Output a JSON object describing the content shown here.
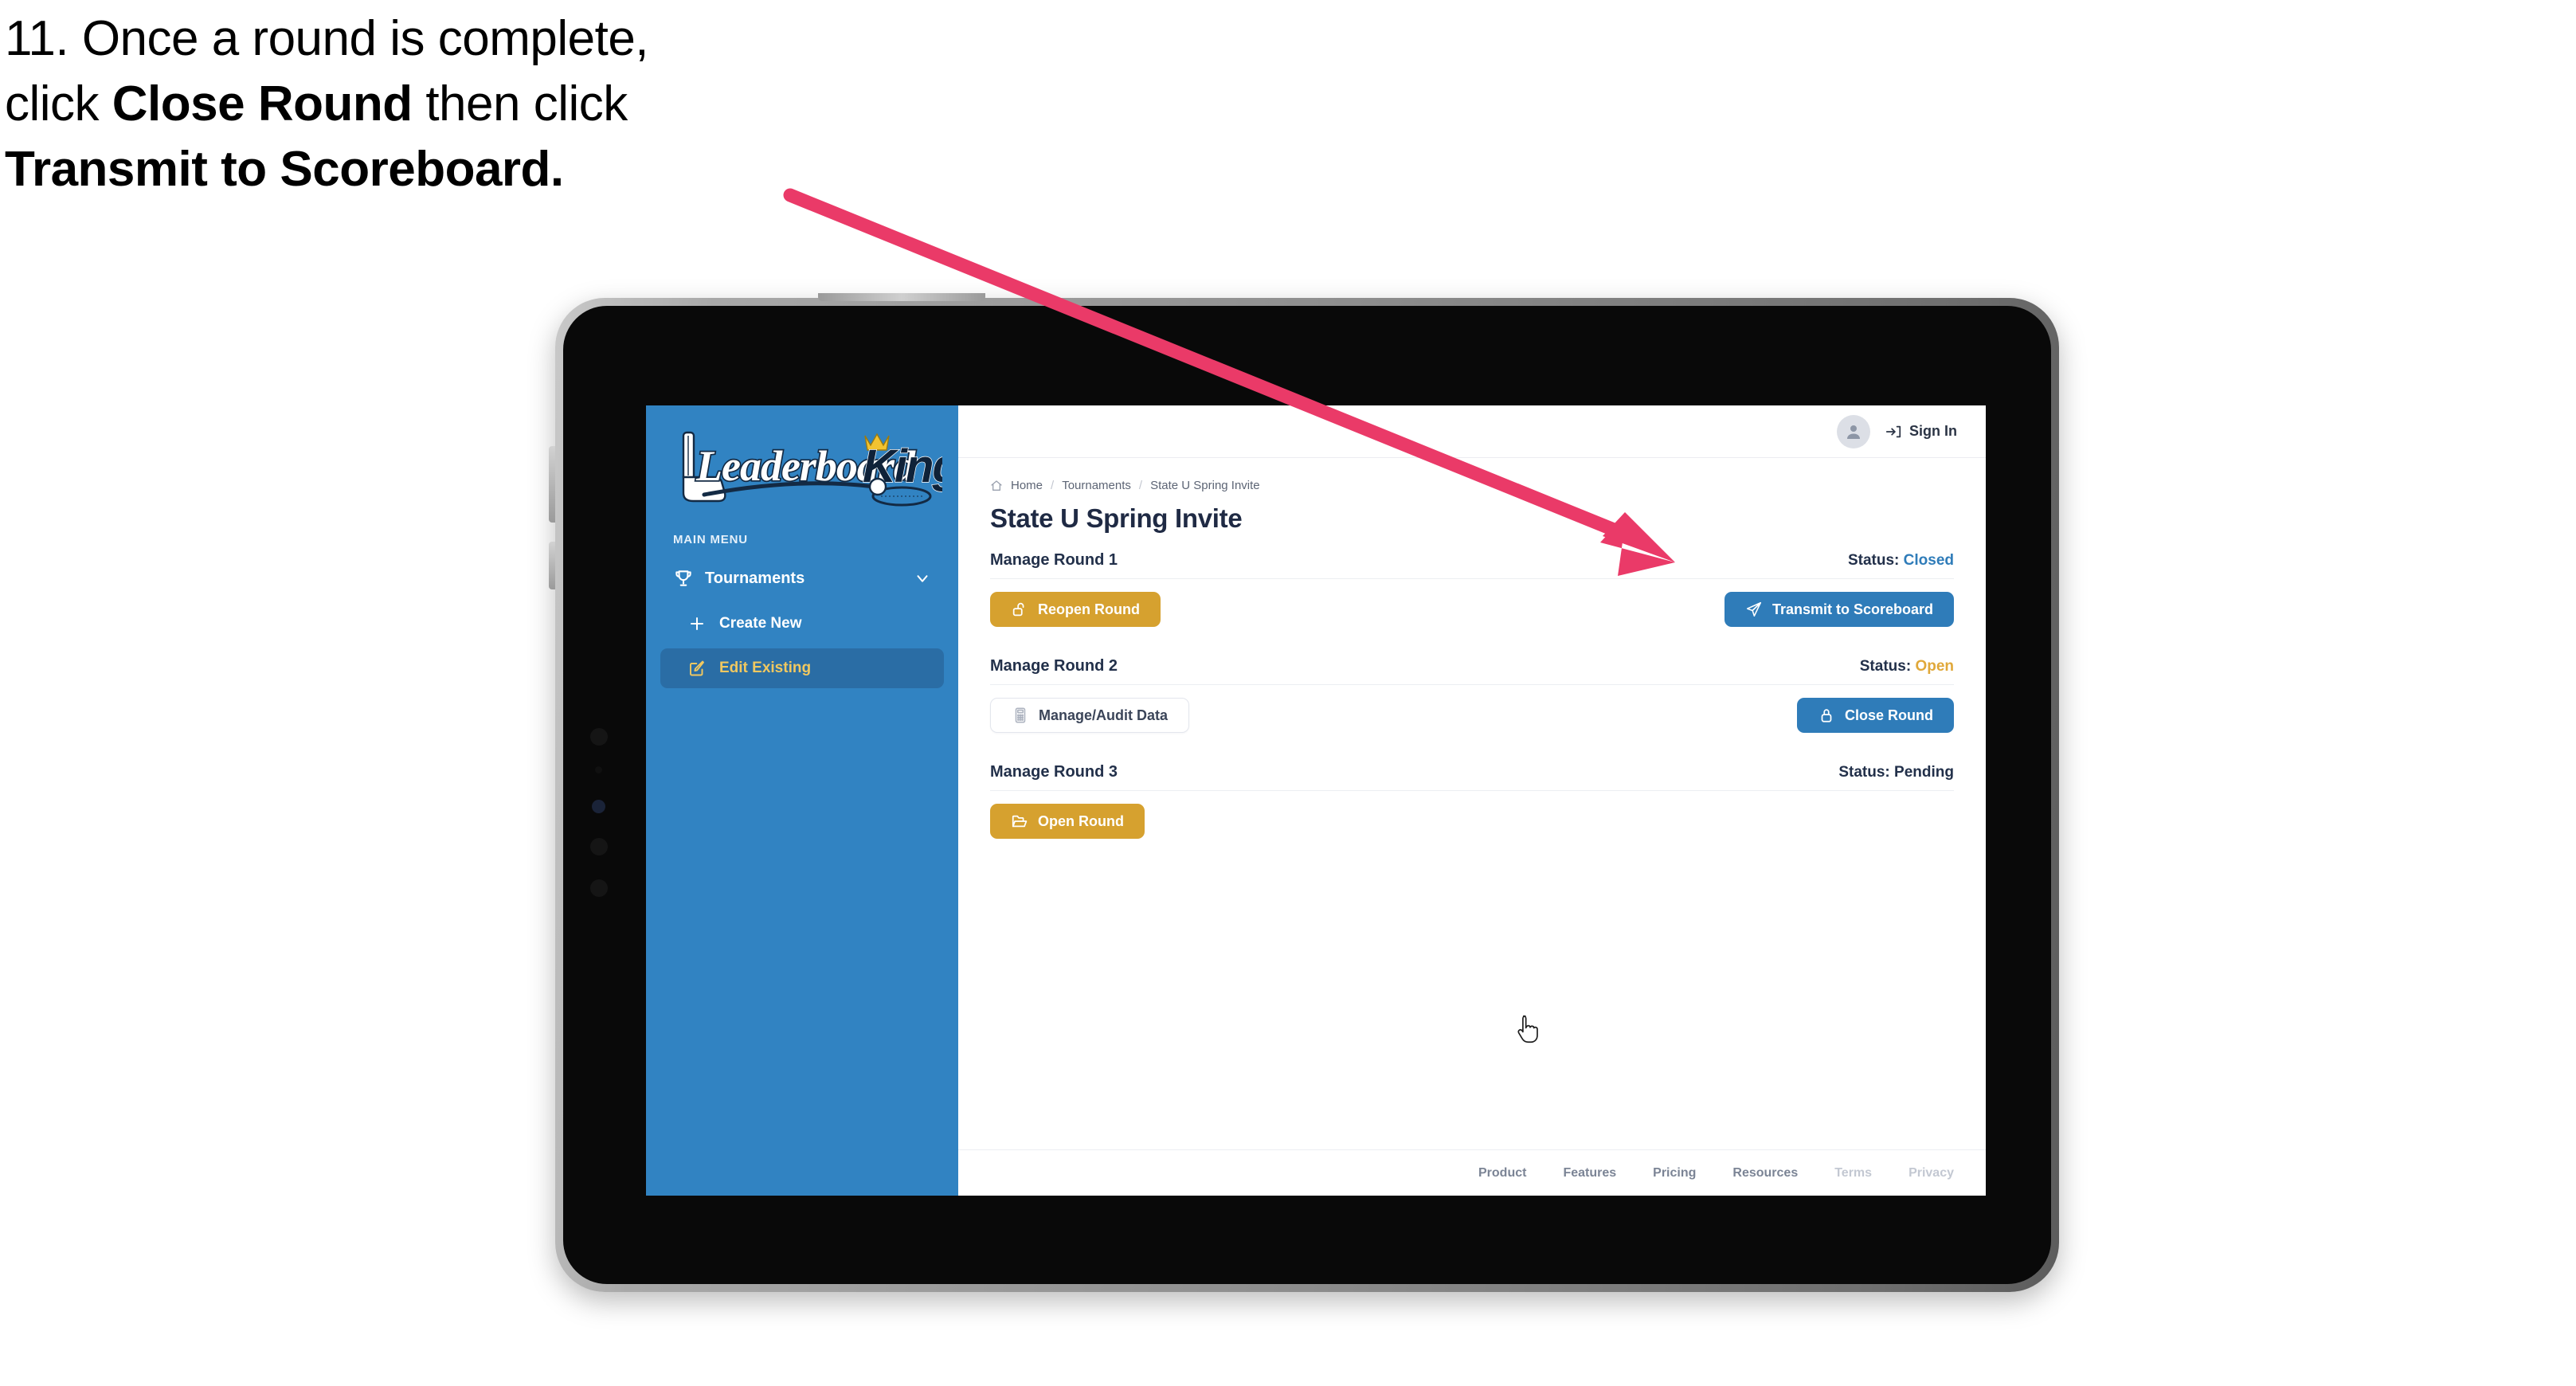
{
  "instruction": {
    "line1": "11. Once a round is complete,",
    "line2_pre": "click ",
    "line2_bold": "Close Round",
    "line2_post": " then click",
    "line3_bold": "Transmit to Scoreboard."
  },
  "annotation": {
    "arrow_color": "#ea3a68",
    "points_to": "Transmit to Scoreboard"
  },
  "sidebar": {
    "logo_primary": "Leaderboard",
    "logo_secondary": "King",
    "menu_label": "MAIN MENU",
    "items": [
      {
        "label": "Tournaments",
        "icon": "trophy-icon",
        "chevron": "chevron-down-icon",
        "active": false
      },
      {
        "label": "Create New",
        "icon": "plus-icon",
        "active": false
      },
      {
        "label": "Edit Existing",
        "icon": "edit-pencil-icon",
        "active": true
      }
    ],
    "bg_color": "#3183c2",
    "active_bg_color": "#2a6da5",
    "active_text_color": "#f0c860"
  },
  "topbar": {
    "avatar_icon": "user-avatar-icon",
    "signin_icon": "sign-in-arrow-icon",
    "signin_label": "Sign In"
  },
  "breadcrumb": {
    "home_icon": "home-icon",
    "items": [
      "Home",
      "Tournaments",
      "State U Spring Invite"
    ],
    "separator": "/"
  },
  "page": {
    "title": "State U Spring Invite"
  },
  "rounds": [
    {
      "name": "Manage Round 1",
      "status_label": "Status:",
      "status_value": "Closed",
      "status_color": "#2f7cb9",
      "left_button": {
        "label": "Reopen Round",
        "icon": "unlock-icon",
        "style": "gold"
      },
      "right_button": {
        "label": "Transmit to Scoreboard",
        "icon": "paper-plane-icon",
        "style": "blue"
      }
    },
    {
      "name": "Manage Round 2",
      "status_label": "Status:",
      "status_value": "Open",
      "status_color": "#e0a83a",
      "left_button": {
        "label": "Manage/Audit Data",
        "icon": "calculator-icon",
        "style": "ghost"
      },
      "right_button": {
        "label": "Close Round",
        "icon": "lock-icon",
        "style": "blue"
      }
    },
    {
      "name": "Manage Round 3",
      "status_label": "Status:",
      "status_value": "Pending",
      "status_color": "#22304a",
      "left_button": {
        "label": "Open Round",
        "icon": "open-folder-icon",
        "style": "gold"
      },
      "right_button": null
    }
  ],
  "footer": {
    "links": [
      {
        "label": "Product",
        "dim": false
      },
      {
        "label": "Features",
        "dim": false
      },
      {
        "label": "Pricing",
        "dim": false
      },
      {
        "label": "Resources",
        "dim": false
      },
      {
        "label": "Terms",
        "dim": true
      },
      {
        "label": "Privacy",
        "dim": true
      }
    ]
  },
  "cursor": {
    "type": "pointing-hand-cursor"
  }
}
